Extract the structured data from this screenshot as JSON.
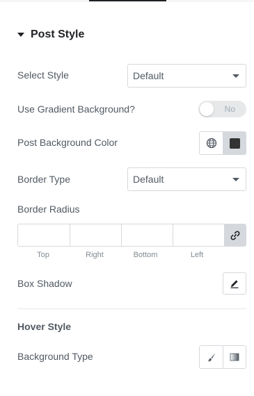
{
  "section": {
    "title": "Post Style",
    "caret_icon": "caret-down-icon"
  },
  "select_style": {
    "label": "Select Style",
    "value": "Default"
  },
  "gradient": {
    "label": "Use Gradient Background?",
    "toggle_text": "No",
    "enabled": false
  },
  "post_bg": {
    "label": "Post Background Color",
    "icons": [
      "globe-icon",
      "color-swatch-icon"
    ],
    "swatch_color": "#333333"
  },
  "border_type": {
    "label": "Border Type",
    "value": "Default"
  },
  "border_radius": {
    "label": "Border Radius",
    "fields": [
      {
        "label": "Top",
        "value": ""
      },
      {
        "label": "Right",
        "value": ""
      },
      {
        "label": "Bottom",
        "value": ""
      },
      {
        "label": "Left",
        "value": ""
      }
    ],
    "link_icon": "link-icon"
  },
  "box_shadow": {
    "label": "Box Shadow",
    "icon": "pencil-icon"
  },
  "hover_style": {
    "heading": "Hover Style"
  },
  "background_type": {
    "label": "Background Type",
    "icons": [
      "brush-icon",
      "gradient-icon"
    ]
  },
  "colors": {
    "text": "#515962",
    "heading": "#1f2124",
    "border": "#d5d8dc",
    "active": "#d5d8dc"
  }
}
